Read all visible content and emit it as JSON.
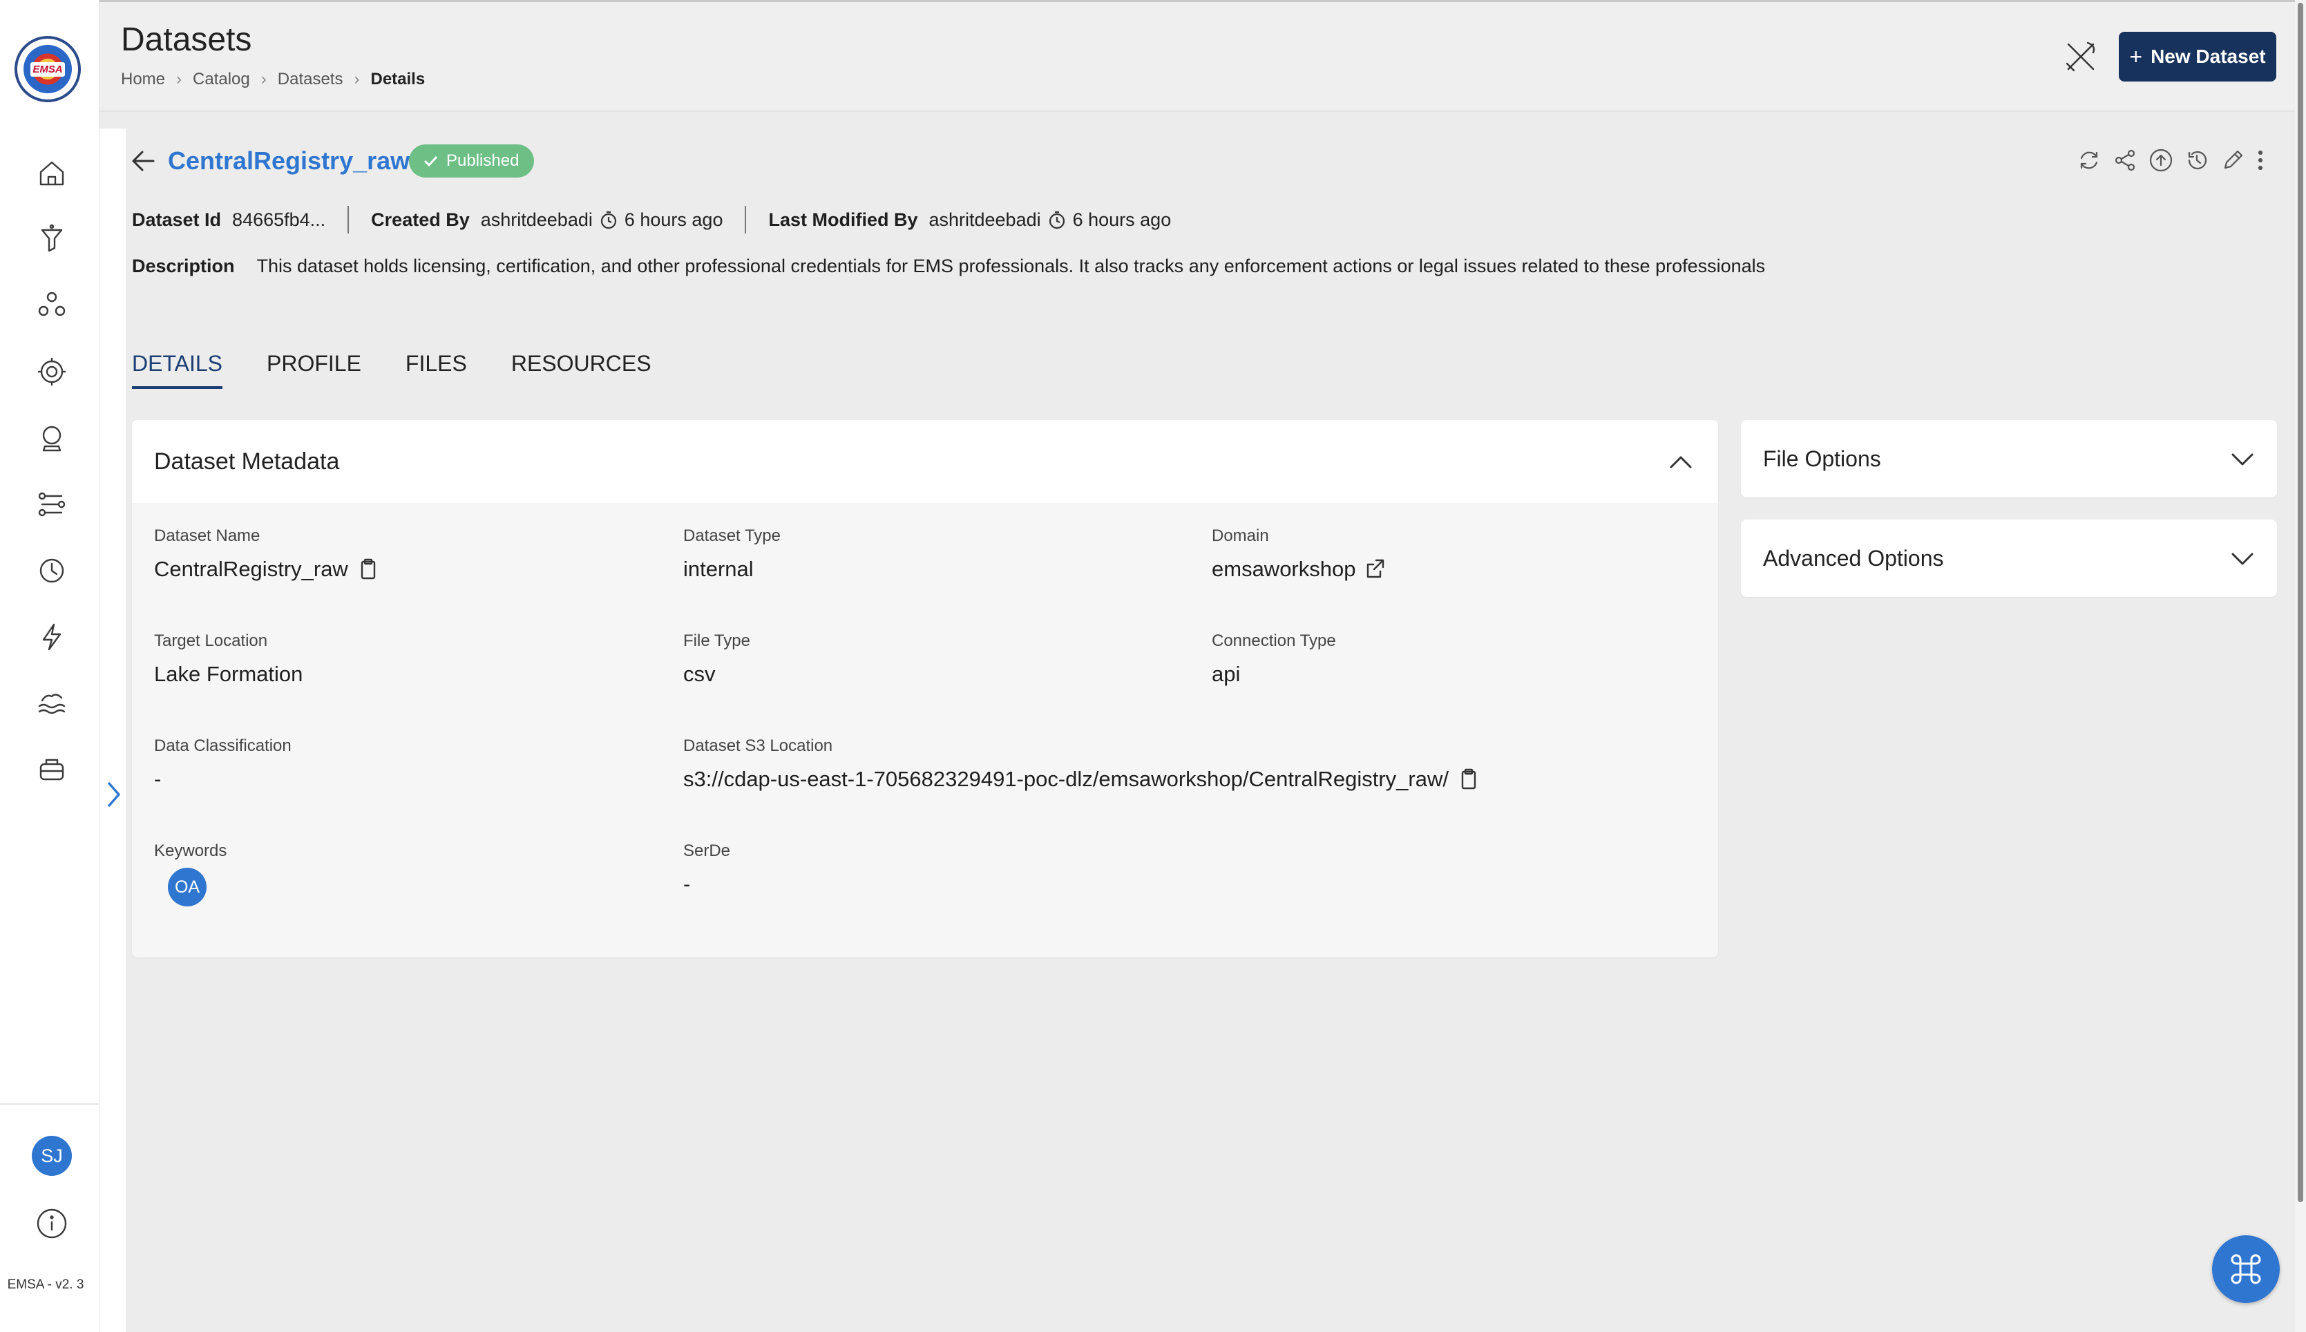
{
  "header": {
    "title": "Datasets",
    "breadcrumbs": [
      "Home",
      "Catalog",
      "Datasets",
      "Details"
    ],
    "new_button_label": "New Dataset"
  },
  "sidebar": {
    "logo_text": "EMSA",
    "nav_items": [
      "home-icon",
      "funnel-icon",
      "cluster-icon",
      "settings-gear-icon",
      "crystal-ball-icon",
      "workflow-icon",
      "clock-icon",
      "lightning-icon",
      "lake-icon",
      "storage-icon"
    ],
    "avatar_initials": "SJ",
    "version": "EMSA - v2. 3"
  },
  "dataset": {
    "name": "CentralRegistry_raw",
    "status": "Published",
    "id_label": "Dataset Id",
    "id_value": "84665fb4...",
    "created_by_label": "Created By",
    "created_by": "ashritdeebadi",
    "created_time": "6 hours ago",
    "modified_by_label": "Last Modified By",
    "modified_by": "ashritdeebadi",
    "modified_time": "6 hours ago",
    "description_label": "Description",
    "description": "This dataset holds licensing, certification, and other professional credentials for EMS professionals. It also tracks any enforcement actions or legal issues related to these professionals"
  },
  "tabs": [
    "DETAILS",
    "PROFILE",
    "FILES",
    "RESOURCES"
  ],
  "metadata": {
    "title": "Dataset Metadata",
    "fields": {
      "dataset_name": {
        "label": "Dataset Name",
        "value": "CentralRegistry_raw"
      },
      "dataset_type": {
        "label": "Dataset Type",
        "value": "internal"
      },
      "domain": {
        "label": "Domain",
        "value": "emsaworkshop"
      },
      "target_location": {
        "label": "Target Location",
        "value": "Lake Formation"
      },
      "file_type": {
        "label": "File Type",
        "value": "csv"
      },
      "connection_type": {
        "label": "Connection Type",
        "value": "api"
      },
      "data_classification": {
        "label": "Data Classification",
        "value": "-"
      },
      "s3_location": {
        "label": "Dataset S3 Location",
        "value": "s3://cdap-us-east-1-705682329491-poc-dlz/emsaworkshop/CentralRegistry_raw/"
      },
      "keywords": {
        "label": "Keywords",
        "value": "OA"
      },
      "serde": {
        "label": "SerDe",
        "value": "-"
      }
    }
  },
  "panels": {
    "file_options": "File Options",
    "advanced_options": "Advanced Options"
  },
  "colors": {
    "primary": "#2f76d0",
    "nav_dark": "#17325c",
    "published": "#6dbf86"
  }
}
